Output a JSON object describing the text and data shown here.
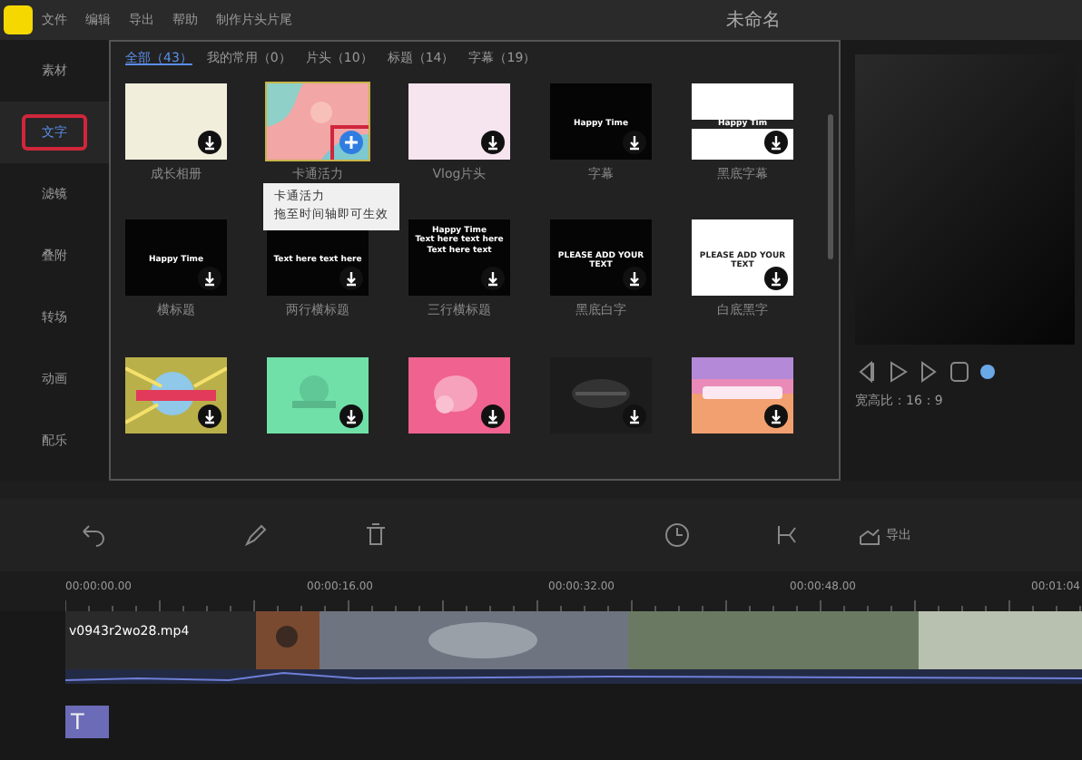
{
  "window": {
    "title": "未命名"
  },
  "menu": [
    "文件",
    "编辑",
    "导出",
    "帮助",
    "制作片头片尾"
  ],
  "sidebar": [
    {
      "label": "素材",
      "selected": false,
      "highlighted": false
    },
    {
      "label": "文字",
      "selected": true,
      "highlighted": true
    },
    {
      "label": "滤镜",
      "selected": false,
      "highlighted": false
    },
    {
      "label": "叠附",
      "selected": false,
      "highlighted": false
    },
    {
      "label": "转场",
      "selected": false,
      "highlighted": false
    },
    {
      "label": "动画",
      "selected": false,
      "highlighted": false
    },
    {
      "label": "配乐",
      "selected": false,
      "highlighted": false
    }
  ],
  "tabs": [
    {
      "label": "全部（43）",
      "selected": true
    },
    {
      "label": "我的常用（0）",
      "selected": false
    },
    {
      "label": "片头（10）",
      "selected": false
    },
    {
      "label": "标题（14）",
      "selected": false
    },
    {
      "label": "字幕（19）",
      "selected": false
    }
  ],
  "templates": [
    {
      "label": "成长相册",
      "color": "#f1eedc",
      "kind": "plain",
      "added": false,
      "highlighted": false
    },
    {
      "label": "卡通活力",
      "color": "#f2a6a6",
      "kind": "cartoon",
      "added": true,
      "highlighted": true
    },
    {
      "label": "Vlog片头",
      "color": "#f6e4ee",
      "kind": "plain",
      "added": false,
      "highlighted": false
    },
    {
      "label": "字幕",
      "color": "#050505",
      "kind": "plain",
      "added": false,
      "highlighted": false,
      "preview": [
        "Happy Time"
      ]
    },
    {
      "label": "黑底字幕",
      "color": "#ffffff",
      "kind": "plain",
      "added": false,
      "highlighted": false,
      "preview": [
        "Happy Tim"
      ]
    },
    {
      "label": "横标题",
      "color": "#050505",
      "kind": "plain",
      "added": false,
      "highlighted": false,
      "preview": [
        "Happy Time"
      ]
    },
    {
      "label": "两行横标题",
      "color": "#050505",
      "kind": "plain",
      "added": false,
      "highlighted": false,
      "preview": [
        "Text here text here"
      ]
    },
    {
      "label": "三行横标题",
      "color": "#050505",
      "kind": "plain",
      "added": false,
      "highlighted": false,
      "preview": [
        "Happy Time",
        "Text here text here",
        "Text here text"
      ]
    },
    {
      "label": "黑底白字",
      "color": "#050505",
      "kind": "plain",
      "added": false,
      "highlighted": false,
      "preview": [
        "PLEASE ADD YOUR TEXT"
      ]
    },
    {
      "label": "白底黑字",
      "color": "#ffffff",
      "kind": "plain",
      "added": false,
      "highlighted": false,
      "preview": [
        "PLEASE ADD YOUR TEXT"
      ]
    },
    {
      "color": "#b9b04a",
      "kind": "picture",
      "added": false,
      "highlighted": false
    },
    {
      "color": "#70e0a8",
      "kind": "picture",
      "added": false,
      "highlighted": false
    },
    {
      "color": "#f0628f",
      "kind": "picture",
      "added": false,
      "highlighted": false
    },
    {
      "color": "#1c1c1c",
      "kind": "picture",
      "added": false,
      "highlighted": false
    },
    {
      "color": "#e98ab8",
      "kind": "picture",
      "added": false,
      "highlighted": false
    }
  ],
  "tooltip": [
    "卡通活力",
    "拖至时间轴即可生效"
  ],
  "preview": {
    "aspect": "宽高比：16：9"
  },
  "toolbar": {
    "export": "导出"
  },
  "ruler": [
    "00:00:00.00",
    "00:00:16.00",
    "00:00:32.00",
    "00:00:48.00",
    "00:01:04"
  ],
  "clip": {
    "name": "v0943r2wo28.mp4"
  },
  "text_track": {
    "icon": "T"
  }
}
